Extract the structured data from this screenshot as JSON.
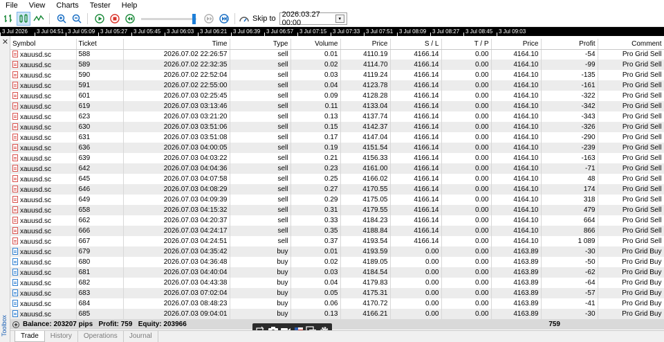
{
  "menu": [
    "File",
    "View",
    "Charts",
    "Tester",
    "Help"
  ],
  "toolbar": {
    "skip_label": "Skip to",
    "skip_date": "2026.03.27 00:00"
  },
  "timeline": [
    "3 Jul 2026",
    "3 Jul 04:51",
    "3 Jul 05:09",
    "3 Jul 05:27",
    "3 Jul 05:45",
    "3 Jul 06:03",
    "3 Jul 06:21",
    "3 Jul 06:39",
    "3 Jul 06:57",
    "3 Jul 07:15",
    "3 Jul 07:33",
    "3 Jul 07:51",
    "3 Jul 08:09",
    "3 Jul 08:27",
    "3 Jul 08:45",
    "3 Jul 09:03"
  ],
  "table": {
    "columns": [
      "Symbol",
      "Ticket",
      "Time",
      "Type",
      "Volume",
      "Price",
      "S / L",
      "T / P",
      "Price",
      "Profit",
      "Comment"
    ],
    "rows": [
      [
        "xauusd.sc",
        "588",
        "2026.07.02 22:26:57",
        "sell",
        "0.01",
        "4110.19",
        "4166.14",
        "0.00",
        "4164.10",
        "-54",
        "Pro Grid Sell"
      ],
      [
        "xauusd.sc",
        "589",
        "2026.07.02 22:32:35",
        "sell",
        "0.02",
        "4114.70",
        "4166.14",
        "0.00",
        "4164.10",
        "-99",
        "Pro Grid Sell"
      ],
      [
        "xauusd.sc",
        "590",
        "2026.07.02 22:52:04",
        "sell",
        "0.03",
        "4119.24",
        "4166.14",
        "0.00",
        "4164.10",
        "-135",
        "Pro Grid Sell"
      ],
      [
        "xauusd.sc",
        "591",
        "2026.07.02 22:55:00",
        "sell",
        "0.04",
        "4123.78",
        "4166.14",
        "0.00",
        "4164.10",
        "-161",
        "Pro Grid Sell"
      ],
      [
        "xauusd.sc",
        "601",
        "2026.07.03 02:25:45",
        "sell",
        "0.09",
        "4128.28",
        "4166.14",
        "0.00",
        "4164.10",
        "-322",
        "Pro Grid Sell"
      ],
      [
        "xauusd.sc",
        "619",
        "2026.07.03 03:13:46",
        "sell",
        "0.11",
        "4133.04",
        "4166.14",
        "0.00",
        "4164.10",
        "-342",
        "Pro Grid Sell"
      ],
      [
        "xauusd.sc",
        "623",
        "2026.07.03 03:21:20",
        "sell",
        "0.13",
        "4137.74",
        "4166.14",
        "0.00",
        "4164.10",
        "-343",
        "Pro Grid Sell"
      ],
      [
        "xauusd.sc",
        "630",
        "2026.07.03 03:51:06",
        "sell",
        "0.15",
        "4142.37",
        "4166.14",
        "0.00",
        "4164.10",
        "-326",
        "Pro Grid Sell"
      ],
      [
        "xauusd.sc",
        "631",
        "2026.07.03 03:51:08",
        "sell",
        "0.17",
        "4147.04",
        "4166.14",
        "0.00",
        "4164.10",
        "-290",
        "Pro Grid Sell"
      ],
      [
        "xauusd.sc",
        "636",
        "2026.07.03 04:00:05",
        "sell",
        "0.19",
        "4151.54",
        "4166.14",
        "0.00",
        "4164.10",
        "-239",
        "Pro Grid Sell"
      ],
      [
        "xauusd.sc",
        "639",
        "2026.07.03 04:03:22",
        "sell",
        "0.21",
        "4156.33",
        "4166.14",
        "0.00",
        "4164.10",
        "-163",
        "Pro Grid Sell"
      ],
      [
        "xauusd.sc",
        "642",
        "2026.07.03 04:04:36",
        "sell",
        "0.23",
        "4161.00",
        "4166.14",
        "0.00",
        "4164.10",
        "-71",
        "Pro Grid Sell"
      ],
      [
        "xauusd.sc",
        "645",
        "2026.07.03 04:07:58",
        "sell",
        "0.25",
        "4166.02",
        "4166.14",
        "0.00",
        "4164.10",
        "48",
        "Pro Grid Sell"
      ],
      [
        "xauusd.sc",
        "646",
        "2026.07.03 04:08:29",
        "sell",
        "0.27",
        "4170.55",
        "4166.14",
        "0.00",
        "4164.10",
        "174",
        "Pro Grid Sell"
      ],
      [
        "xauusd.sc",
        "649",
        "2026.07.03 04:09:39",
        "sell",
        "0.29",
        "4175.05",
        "4166.14",
        "0.00",
        "4164.10",
        "318",
        "Pro Grid Sell"
      ],
      [
        "xauusd.sc",
        "658",
        "2026.07.03 04:15:32",
        "sell",
        "0.31",
        "4179.55",
        "4166.14",
        "0.00",
        "4164.10",
        "479",
        "Pro Grid Sell"
      ],
      [
        "xauusd.sc",
        "662",
        "2026.07.03 04:20:37",
        "sell",
        "0.33",
        "4184.23",
        "4166.14",
        "0.00",
        "4164.10",
        "664",
        "Pro Grid Sell"
      ],
      [
        "xauusd.sc",
        "666",
        "2026.07.03 04:24:17",
        "sell",
        "0.35",
        "4188.84",
        "4166.14",
        "0.00",
        "4164.10",
        "866",
        "Pro Grid Sell"
      ],
      [
        "xauusd.sc",
        "667",
        "2026.07.03 04:24:51",
        "sell",
        "0.37",
        "4193.54",
        "4166.14",
        "0.00",
        "4164.10",
        "1 089",
        "Pro Grid Sell"
      ],
      [
        "xauusd.sc",
        "679",
        "2026.07.03 04:35:42",
        "buy",
        "0.01",
        "4193.59",
        "0.00",
        "0.00",
        "4163.89",
        "-30",
        "Pro Grid Buy"
      ],
      [
        "xauusd.sc",
        "680",
        "2026.07.03 04:36:48",
        "buy",
        "0.02",
        "4189.05",
        "0.00",
        "0.00",
        "4163.89",
        "-50",
        "Pro Grid Buy"
      ],
      [
        "xauusd.sc",
        "681",
        "2026.07.03 04:40:04",
        "buy",
        "0.03",
        "4184.54",
        "0.00",
        "0.00",
        "4163.89",
        "-62",
        "Pro Grid Buy"
      ],
      [
        "xauusd.sc",
        "682",
        "2026.07.03 04:43:38",
        "buy",
        "0.04",
        "4179.83",
        "0.00",
        "0.00",
        "4163.89",
        "-64",
        "Pro Grid Buy"
      ],
      [
        "xauusd.sc",
        "683",
        "2026.07.03 07:02:04",
        "buy",
        "0.05",
        "4175.31",
        "0.00",
        "0.00",
        "4163.89",
        "-57",
        "Pro Grid Buy"
      ],
      [
        "xauusd.sc",
        "684",
        "2026.07.03 08:48:23",
        "buy",
        "0.06",
        "4170.72",
        "0.00",
        "0.00",
        "4163.89",
        "-41",
        "Pro Grid Buy"
      ],
      [
        "xauusd.sc",
        "685",
        "2026.07.03 09:04:01",
        "buy",
        "0.13",
        "4166.21",
        "0.00",
        "0.00",
        "4163.89",
        "-30",
        "Pro Grid Buy"
      ]
    ]
  },
  "summary": {
    "text": "Balance: 203207 pips   Profit: 759   Equity: 203966",
    "profit_total": "759"
  },
  "tabs": [
    "Trade",
    "History",
    "Operations",
    "Journal"
  ],
  "side": {
    "label": "Toolbox"
  }
}
